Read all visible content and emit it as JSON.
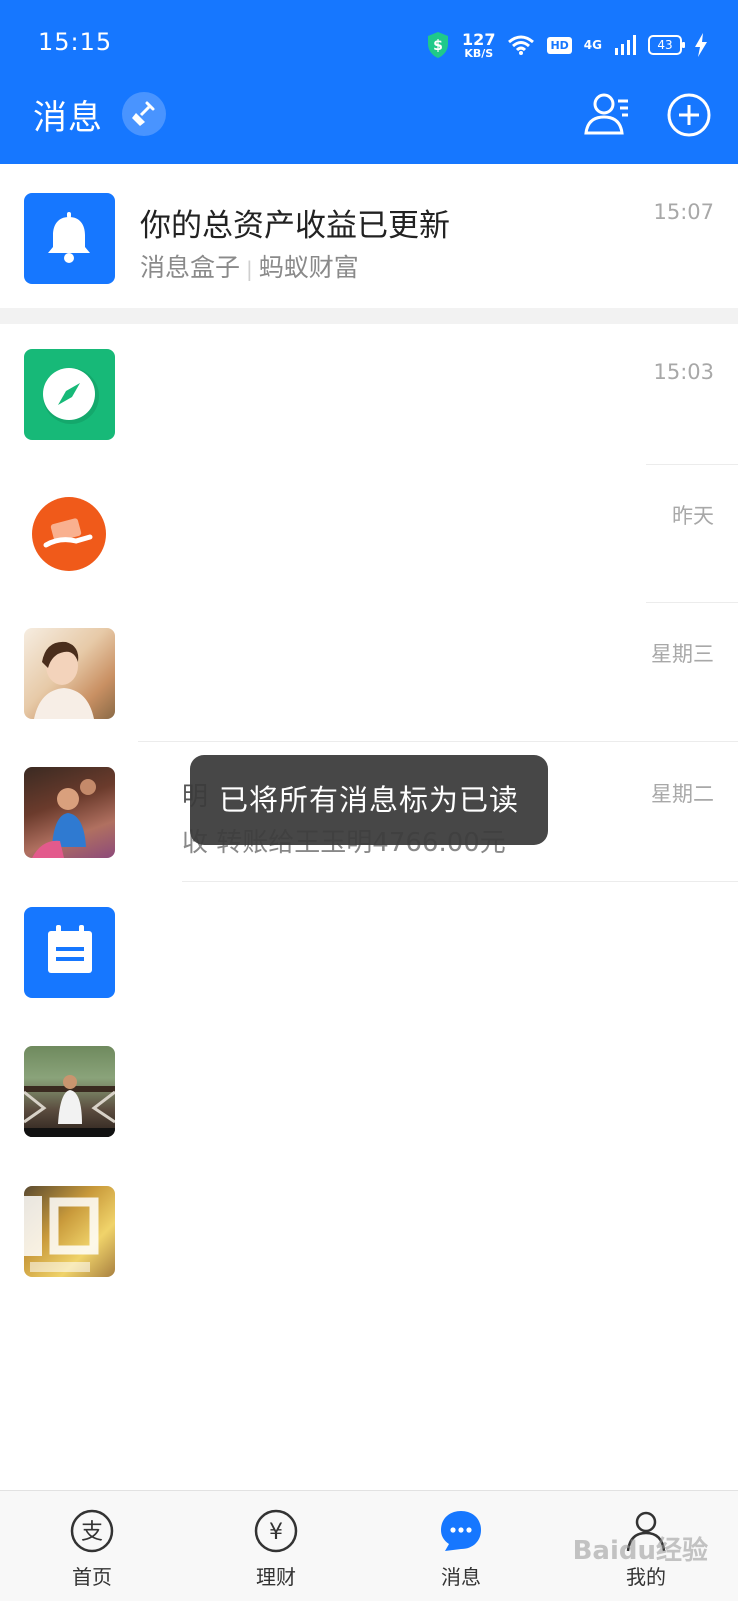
{
  "status_bar": {
    "time": "15:15",
    "net_speed_value": "127",
    "net_speed_unit": "KB/S",
    "hd_label": "HD",
    "signal_label": "4G",
    "battery": "43"
  },
  "header": {
    "title": "消息"
  },
  "pinned": {
    "title": "你的总资产收益已更新",
    "source": "消息盒子",
    "subsource": "蚂蚁财富",
    "time": "15:07"
  },
  "conversations": [
    {
      "time": "15:03",
      "icon": "compass-icon"
    },
    {
      "time": "昨天",
      "icon": "transfer-icon"
    },
    {
      "time": "星期三",
      "icon": "photo-avatar"
    },
    {
      "time": "星期二",
      "icon": "photo-avatar",
      "title_partial": "明",
      "preview_partial": "转账给王玉明4766.00元",
      "preview_prefix": "收"
    },
    {
      "icon": "notepad-icon"
    },
    {
      "icon": "photo-avatar"
    },
    {
      "icon": "photo-avatar"
    }
  ],
  "toast": "已将所有消息标为已读",
  "tabs": [
    {
      "label": "首页",
      "icon": "alipay-icon"
    },
    {
      "label": "理财",
      "icon": "yuan-icon"
    },
    {
      "label": "消息",
      "icon": "chat-icon",
      "active": true
    },
    {
      "label": "我的",
      "icon": "user-icon"
    }
  ],
  "watermark": "Baidu经验",
  "colors": {
    "brand": "#1677ff",
    "compass_green": "#17b978",
    "transfer_orange": "#f05a1a"
  }
}
